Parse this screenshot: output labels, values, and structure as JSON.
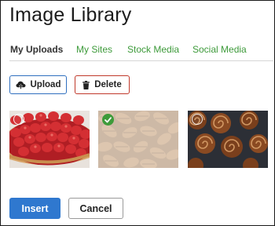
{
  "dialog": {
    "title": "Image Library"
  },
  "tabs": [
    {
      "label": "My Uploads",
      "active": true
    },
    {
      "label": "My Sites",
      "active": false
    },
    {
      "label": "Stock Media",
      "active": false
    },
    {
      "label": "Social Media",
      "active": false
    }
  ],
  "toolbar": {
    "upload_label": "Upload",
    "upload_icon": "cloud-upload-icon",
    "delete_label": "Delete",
    "delete_icon": "trash-icon"
  },
  "images": [
    {
      "subject": "strawberry-tart",
      "selected": false
    },
    {
      "subject": "pecans",
      "selected": true
    },
    {
      "subject": "cinnamon-rolls",
      "selected": false
    }
  ],
  "footer": {
    "insert_label": "Insert",
    "cancel_label": "Cancel"
  },
  "colors": {
    "tab_link": "#3d9a3a",
    "upload_border": "#2f6fbf",
    "delete_border": "#c0392b",
    "insert_bg": "#2f78cf",
    "selected_check": "#3e9b3a"
  }
}
